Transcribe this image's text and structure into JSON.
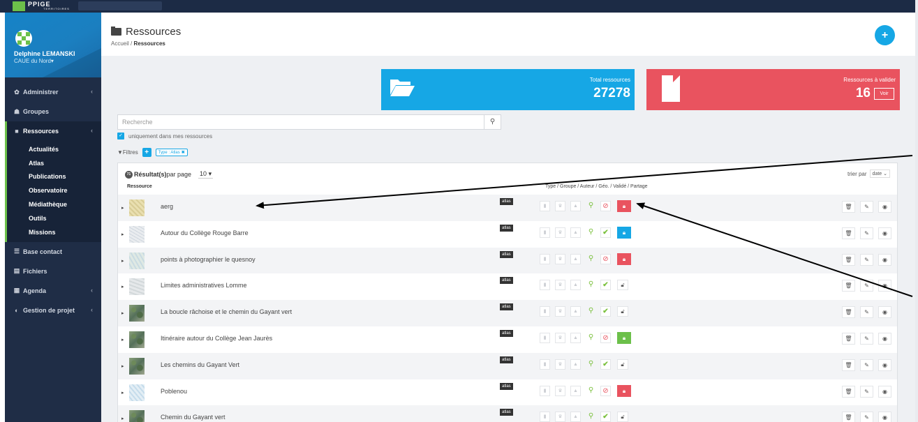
{
  "topbar": {
    "logo_text": "PPIGE",
    "logo_sub": "TERRITOIRES"
  },
  "sidebar": {
    "user_name": "Delphine LEMANSKI",
    "user_org": "CAUE du Nord",
    "items": [
      {
        "label": "Administrer",
        "icon": "gear-icon",
        "arrow": "‹"
      },
      {
        "label": "Groupes",
        "icon": "users-icon",
        "arrow": ""
      },
      {
        "label": "Ressources",
        "icon": "folder-icon",
        "arrow": "‹",
        "active": true
      },
      {
        "label": "Base contact",
        "icon": "contacts-icon",
        "arrow": ""
      },
      {
        "label": "Fichiers",
        "icon": "files-icon",
        "arrow": ""
      },
      {
        "label": "Agenda",
        "icon": "calendar-icon",
        "arrow": "‹"
      },
      {
        "label": "Gestion de projet",
        "icon": "project-icon",
        "arrow": "‹"
      }
    ],
    "subitems": [
      "Actualités",
      "Atlas",
      "Publications",
      "Observatoire",
      "Médiathèque",
      "Outils",
      "Missions"
    ]
  },
  "header": {
    "title": "Ressources",
    "breadcrumb_home": "Accueil",
    "breadcrumb_sep": "/",
    "breadcrumb_current": "Ressources",
    "add_label": "+"
  },
  "stats": {
    "total_label": "Total ressources",
    "total_value": "27278",
    "validate_label": "Ressources à valider",
    "validate_value": "16",
    "voir_label": "Voir"
  },
  "search": {
    "placeholder": "Recherche",
    "only_mine_label": "uniquement dans mes ressources"
  },
  "filters": {
    "label": "Filtres",
    "tag": "Type : Atlas"
  },
  "results": {
    "count": "71",
    "label": "Résultat(s)",
    "per_page_label": "par page",
    "per_page_value": "10",
    "sort_label": "trier par",
    "sort_value": "date",
    "col_resource": "Ressource",
    "col_meta": "Type / Groupe / Auteur / Géo. / Validé / Partage",
    "type_badge": "atlas"
  },
  "rows": [
    {
      "title": "aerg",
      "thumb": "map1",
      "valid": "no",
      "share": "red"
    },
    {
      "title": "Autour du Collège Rouge Barre",
      "thumb": "map2",
      "valid": "ok",
      "share": "blue"
    },
    {
      "title": "points à photographier le quesnoy",
      "thumb": "map3",
      "valid": "no",
      "share": "red"
    },
    {
      "title": "Limites administratives Lomme",
      "thumb": "map4",
      "valid": "ok",
      "share": "none"
    },
    {
      "title": "La boucle râchoise et le chemin du Gayant vert",
      "thumb": "sat",
      "valid": "ok",
      "share": "none"
    },
    {
      "title": "Itinéraire autour du Collège Jean Jaurès",
      "thumb": "sat",
      "valid": "no",
      "share": "green"
    },
    {
      "title": "Les chemins du Gayant Vert",
      "thumb": "sat",
      "valid": "ok",
      "share": "none"
    },
    {
      "title": "Poblenou",
      "thumb": "map5",
      "valid": "no",
      "share": "red"
    },
    {
      "title": "Chemin du Gayant vert",
      "thumb": "sat",
      "valid": "ok",
      "share": "none"
    }
  ],
  "colors": {
    "accent_blue": "#16a7e5",
    "accent_red": "#e9535f",
    "accent_green": "#6cc04a",
    "sidebar_bg": "#1f2d46"
  }
}
